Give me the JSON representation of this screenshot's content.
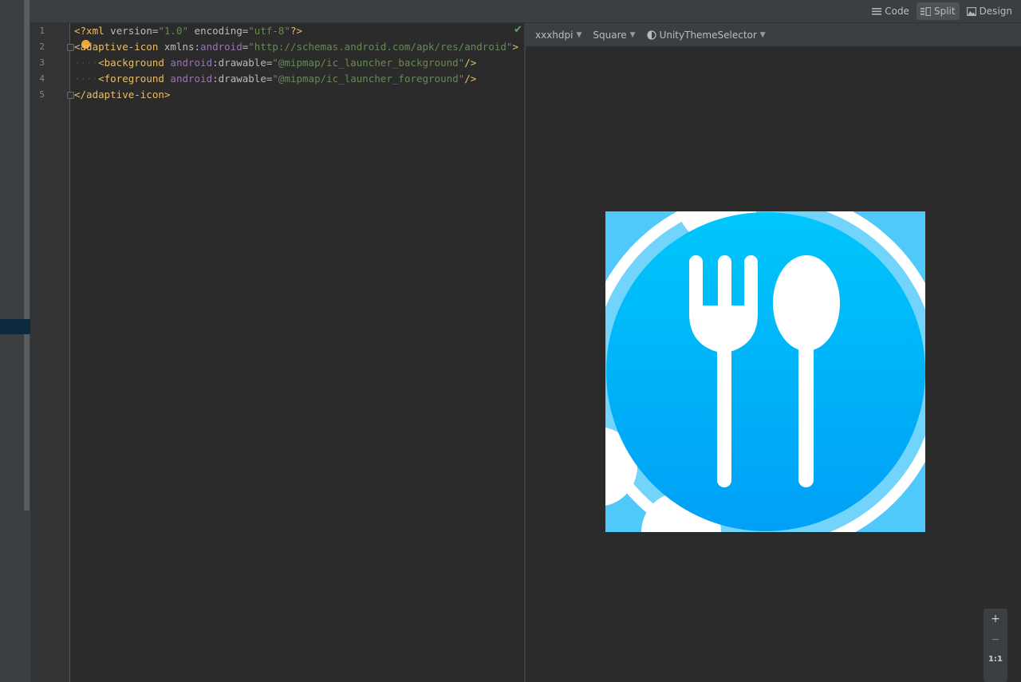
{
  "view_modes": {
    "code": "Code",
    "split": "Split",
    "design": "Design",
    "active": "split"
  },
  "editor": {
    "lines": [
      "1",
      "2",
      "3",
      "4",
      "5"
    ],
    "line1": {
      "decl_open": "<?xml",
      "version_attr": " version=",
      "version_val": "\"1.0\"",
      "enc_attr": " encoding=",
      "enc_val": "\"utf-8\"",
      "decl_close": "?>"
    },
    "line2": {
      "open": "<adaptive-icon",
      "xmlns_attr": " xmlns:",
      "ns": "android",
      "eq": "=",
      "val": "\"http://schemas.android.com/apk/res/android\"",
      "close": ">"
    },
    "line3": {
      "dots": "····",
      "open": "<background",
      "ns": " android",
      "attr": ":drawable=",
      "val": "\"@mipmap/ic_launcher_background\"",
      "close": "/>"
    },
    "line4": {
      "dots": "····",
      "open": "<foreground",
      "ns": " android",
      "attr": ":drawable=",
      "val": "\"@mipmap/ic_launcher_foreground\"",
      "close": "/>"
    },
    "line5": {
      "close": "</adaptive-icon>"
    }
  },
  "preview": {
    "density": "xxxhdpi",
    "shape": "Square",
    "theme": "UnityThemeSelector",
    "icon_colors": {
      "top": "#00c6fb",
      "bottom": "#00a0f6",
      "ring": "#ffffff"
    }
  },
  "zoom": {
    "in": "+",
    "out": "−",
    "actual": "1:1"
  }
}
